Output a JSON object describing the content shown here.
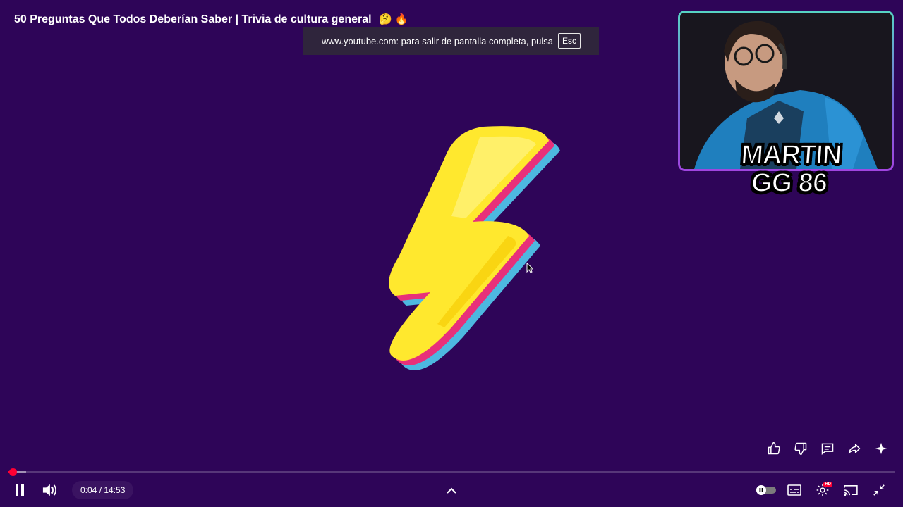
{
  "video": {
    "title": "50 Preguntas Que Todos Deberían Saber | Trivia de cultura general",
    "title_emojis": "🤔 🔥"
  },
  "fullscreen_toast": {
    "message": "www.youtube.com: para salir de pantalla completa, pulsa",
    "key": "Esc"
  },
  "overlay": {
    "streamer_name_line1": "MARTIN",
    "streamer_name_line2": "GG 86",
    "webcam_border_colors": [
      "#56d4c4",
      "#a045e0"
    ]
  },
  "player": {
    "current_time": "0:04",
    "separator": " / ",
    "duration": "14:53",
    "progress_fraction": 0.0045,
    "buffered_fraction": 0.02,
    "state": "playing",
    "quality_badge": "HD",
    "background_color": "#2e0558",
    "accent_color": "#ff0033"
  },
  "actions": [
    "thumbs-up-icon",
    "thumbs-down-icon",
    "comments-icon",
    "share-icon",
    "sparkle-icon"
  ],
  "controls_right": [
    "autoplay-toggle",
    "subtitles-icon",
    "settings-icon",
    "cast-icon",
    "exit-fullscreen-icon"
  ]
}
